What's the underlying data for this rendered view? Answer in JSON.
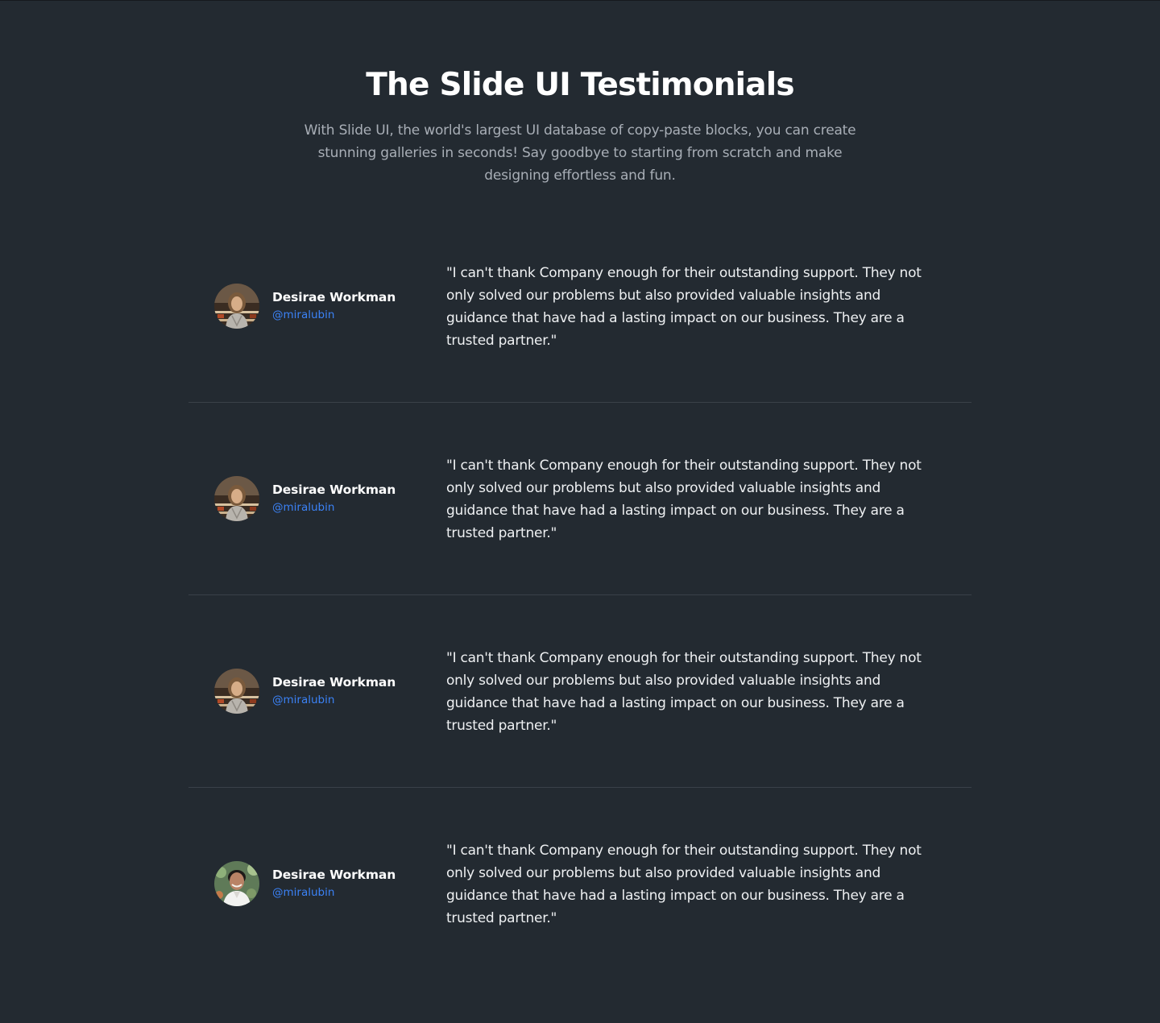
{
  "header": {
    "title": "The Slide UI Testimonials",
    "subtitle": "With Slide UI, the world's largest UI database of copy-paste blocks, you can create stunning galleries in seconds! Say goodbye to starting from scratch and make designing effortless and fun."
  },
  "colors": {
    "background": "#232a31",
    "handle": "#3b82f6",
    "divider": "#3a4149"
  },
  "testimonials": [
    {
      "name": "Desirae Workman",
      "handle": "@miralubin",
      "quote": "\"I can't thank Company enough for their outstanding support. They not only solved our problems but also provided valuable insights and guidance that have had a lasting impact on our business. They are a trusted partner.\"",
      "avatar": "woman-portrait"
    },
    {
      "name": "Desirae Workman",
      "handle": "@miralubin",
      "quote": "\"I can't thank Company enough for their outstanding support. They not only solved our problems but also provided valuable insights and guidance that have had a lasting impact on our business. They are a trusted partner.\"",
      "avatar": "woman-portrait"
    },
    {
      "name": "Desirae Workman",
      "handle": "@miralubin",
      "quote": "\"I can't thank Company enough for their outstanding support. They not only solved our problems but also provided valuable insights and guidance that have had a lasting impact on our business. They are a trusted partner.\"",
      "avatar": "woman-portrait"
    },
    {
      "name": "Desirae Workman",
      "handle": "@miralubin",
      "quote": "\"I can't thank Company enough for their outstanding support. They not only solved our problems but also provided valuable insights and guidance that have had a lasting impact on our business. They are a trusted partner.\"",
      "avatar": "man-portrait"
    }
  ]
}
